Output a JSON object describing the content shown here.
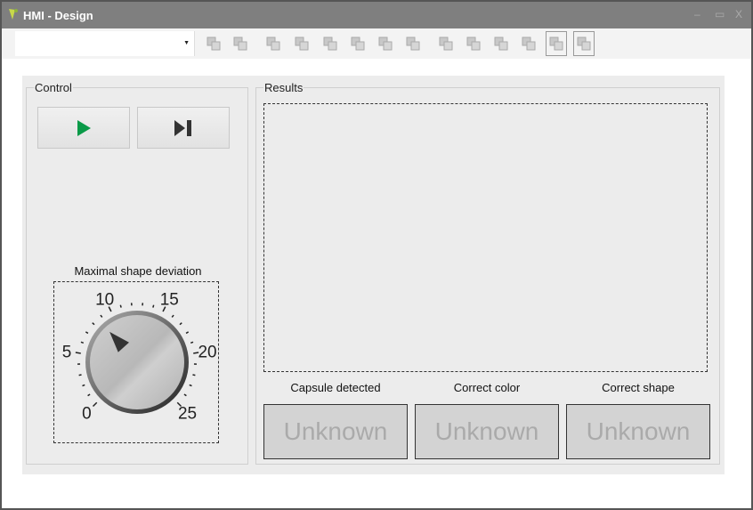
{
  "window": {
    "title": "HMI - Design",
    "minimize": "–",
    "maximize": "▭",
    "close": "X"
  },
  "toolbar": {
    "combo_value": "",
    "tools": [
      "bring-to-front",
      "send-to-back",
      "align-left",
      "align-center",
      "align-right",
      "align-top",
      "align-middle",
      "align-bottom",
      "same-width",
      "same-height",
      "h-spacing",
      "v-spacing",
      "center-horizontal",
      "center-vertical"
    ]
  },
  "control": {
    "label": "Control",
    "play_icon": "play-icon",
    "step_icon": "step-forward-icon",
    "play_color": "#0a9a48"
  },
  "knob": {
    "label": "Maximal shape deviation",
    "min": 0,
    "max": 25,
    "value": 8.6,
    "tick_labels": [
      "0",
      "5",
      "10",
      "15",
      "20",
      "25"
    ]
  },
  "results": {
    "label": "Results",
    "indicators": [
      {
        "caption": "Capsule detected",
        "status": "Unknown"
      },
      {
        "caption": "Correct color",
        "status": "Unknown"
      },
      {
        "caption": "Correct shape",
        "status": "Unknown"
      }
    ]
  }
}
